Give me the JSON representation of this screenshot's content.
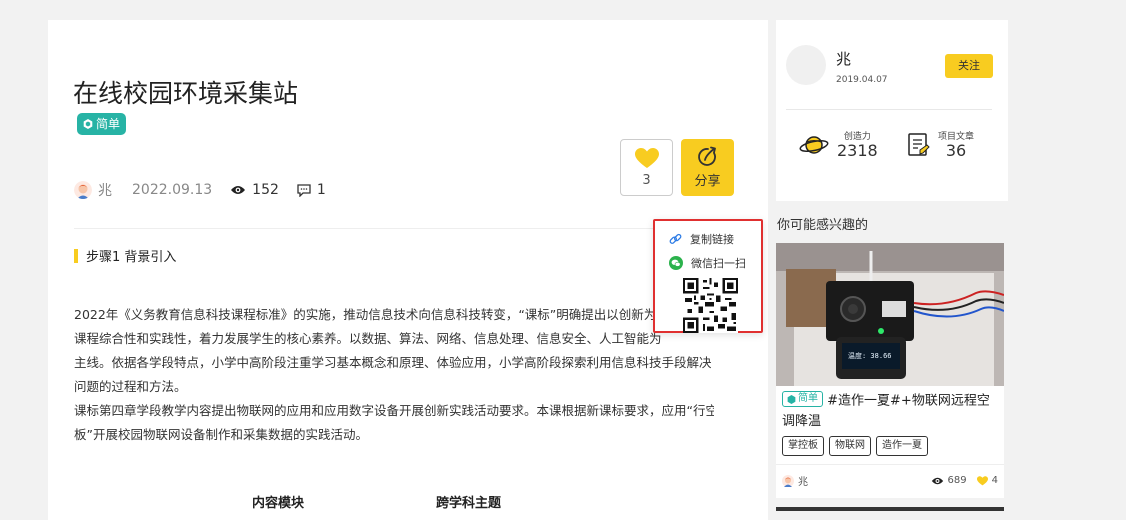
{
  "article": {
    "title": "在线校园环境采集站",
    "level": "简单",
    "author": "兆",
    "date": "2022.09.13",
    "views": "152",
    "comments": "1",
    "likes": "3",
    "share_label": "分享",
    "step_title": "步骤1 背景引入",
    "paragraphs": [
      "2022年《义务教育信息科技课程标准》的实施，推动信息技术向信息科技转变，“课标”明确提出以创新为",
      "课程综合性和实践性，着力发展学生的核心素养。以数据、算法、网络、信息处理、信息安全、人工智能为",
      "主线。依据各学段特点，小学中高阶段注重学习基本概念和原理、体验应用，小学高阶段探索利用信息科技手段解决",
      "问题的过程和方法。",
      "课标第四章学段教学内容提出物联网的应用和应用数字设备开展创新实践活动要求。本课根据新课标要求，应用“行空",
      "板”开展校园物联网设备制作和采集数据的实践活动。"
    ],
    "table_headers": [
      "内容模块",
      "跨学科主题"
    ]
  },
  "share_popup": {
    "copy_link": "复制链接",
    "wechat_scan": "微信扫一扫"
  },
  "author_card": {
    "name": "兆",
    "date": "2019.04.07",
    "follow_label": "关注",
    "creativity_label": "创造力",
    "creativity_value": "2318",
    "projects_label": "项目文章",
    "projects_value": "36"
  },
  "recommend": {
    "section_title": "你可能感兴趣的",
    "level": "简单",
    "title": "#造作一夏#+物联网远程空调降温",
    "tags": [
      "掌控板",
      "物联网",
      "造作一夏"
    ],
    "author": "兆",
    "views": "689",
    "likes": "4",
    "screen_text": "温度: 38.66"
  },
  "colors": {
    "accent": "#f8cc20",
    "badge": "#27b3a5",
    "highlight_border": "#e03030"
  }
}
